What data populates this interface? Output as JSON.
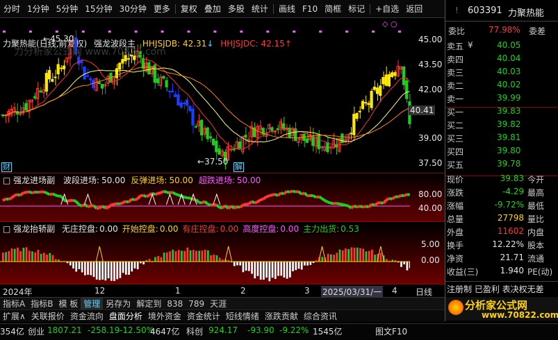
{
  "toolbar": {
    "items": [
      "分时",
      "1分钟",
      "5分钟",
      "15分钟",
      "30分钟",
      "更多",
      "复权",
      "叠加",
      "多股",
      "统计",
      "画线",
      "F10",
      "简框",
      "标记",
      "+自选",
      "返回"
    ]
  },
  "main_chart": {
    "stock_name": "力聚热能",
    "mode": "(日线,前复权)",
    "indicator_name": "强龙波段主",
    "hhjsjdb_label": "HHJSJDB:",
    "hhjsjdb_value": "42.31",
    "hhjsjdc_label": "HHJSJDC:",
    "hhjsjdc_value": "42.15",
    "high_marker": "45.30",
    "low_marker": "37.50",
    "cai_label": "财",
    "jie_label": "解",
    "watermark": "力分析家公式网 www.70822.com",
    "price_scale": [
      "45.00",
      "43.50",
      "42.00",
      "40.41",
      "39.00",
      "37.50"
    ]
  },
  "sub1": {
    "title": "强龙进场副",
    "items": [
      {
        "label": "波段进场:",
        "value": "50.00",
        "color": "white"
      },
      {
        "label": "反弹进场:",
        "value": "50.00",
        "color": "yellow"
      },
      {
        "label": "超跌进场:",
        "value": "50.00",
        "color": "pink"
      }
    ],
    "scale": [
      "80.00",
      "40.00"
    ]
  },
  "sub2": {
    "title": "强龙抬轿副",
    "items": [
      {
        "label": "无庄控盘:",
        "value": "0.00",
        "color": "white"
      },
      {
        "label": "开始控盘:",
        "value": "0.00",
        "color": "yellow"
      },
      {
        "label": "有庄控盘:",
        "value": "0.00",
        "color": "red"
      },
      {
        "label": "高度控盘:",
        "value": "0.00",
        "color": "pink"
      },
      {
        "label": "主力出货:",
        "value": "0.53",
        "color": "green"
      }
    ],
    "scale": [
      "5.00",
      "0.00"
    ]
  },
  "time_axis": [
    "2024年",
    "12",
    "1",
    "2",
    "3",
    "2025/03/31/一",
    "4"
  ],
  "bottom_tabs": [
    "指标A",
    "指标B",
    "模 板",
    "管理",
    "另存为",
    "解定到",
    "838",
    "789",
    "天涯"
  ],
  "info_tabs": [
    "扩展∧",
    "关联报价",
    "资金流向",
    "盘面分析",
    "境外资金",
    "资金统计",
    "短线情绪",
    "涨跌贡献",
    "综合资讯"
  ],
  "right_panel": {
    "code": "603391",
    "name": "力聚热能",
    "weibi_label": "委比",
    "weibi_value": "77.98%",
    "weicha_label": "委差",
    "asks": [
      {
        "label": "卖五",
        "flag": "¥",
        "price": "40.05"
      },
      {
        "label": "卖四",
        "flag": "",
        "price": "40.04"
      },
      {
        "label": "卖三",
        "flag": "",
        "price": "40.03"
      },
      {
        "label": "卖二",
        "flag": "",
        "price": "40.02"
      },
      {
        "label": "卖一",
        "flag": "",
        "price": "39.99"
      }
    ],
    "bids": [
      {
        "label": "买一",
        "price": "39.83"
      },
      {
        "label": "买二",
        "price": "39.82"
      },
      {
        "label": "买三",
        "price": "39.81"
      },
      {
        "label": "买四",
        "price": "39.80"
      },
      {
        "label": "买五",
        "price": "39.78"
      }
    ],
    "stats": [
      {
        "l1": "现价",
        "v1": "39.83",
        "c1": "green",
        "l2": "今开",
        "v2": ""
      },
      {
        "l1": "涨跌",
        "v1": "-4.29",
        "c1": "green",
        "l2": "最高",
        "v2": ""
      },
      {
        "l1": "涨幅",
        "v1": "-9.72%",
        "c1": "green",
        "l2": "最低",
        "v2": ""
      },
      {
        "l1": "总量",
        "v1": "27798",
        "c1": "yellow",
        "l2": "量比",
        "v2": ""
      },
      {
        "l1": "外盘",
        "v1": "11602",
        "c1": "red",
        "l2": "内盘",
        "v2": ""
      },
      {
        "l1": "换手",
        "v1": "12.22%",
        "c1": "white",
        "l2": "股本",
        "v2": ""
      },
      {
        "l1": "净资",
        "v1": "21.71",
        "c1": "white",
        "l2": "流通",
        "v2": ""
      },
      {
        "l1": "收益(三)",
        "v1": "1.940",
        "c1": "white",
        "l2": "PE(动)",
        "v2": ""
      }
    ],
    "footer1": "注册制 已盈利 表决权无差",
    "footer2": "分析家公式网",
    "footer3": "www.70822.com"
  },
  "status_bar": {
    "seg1": "354亿",
    "chuangye_label": "创业",
    "chuangye_value": "1807.21",
    "chuangye_change": "-258.19",
    "chuangye_pct": "-12.50%",
    "chuangye_amt": "4647亿",
    "kechuang_label": "科创",
    "kechuang_value": "924.17",
    "kechuang_change": "-93.90",
    "kechuang_pct": "-9.22%",
    "kechuang_amt": "1545亿",
    "f10": "图文F10"
  },
  "colors": {
    "up": "#ff3838",
    "down": "#19d219",
    "flat": "#ffd400",
    "accent": "#ff55ff",
    "blue": "#1e3cff"
  }
}
